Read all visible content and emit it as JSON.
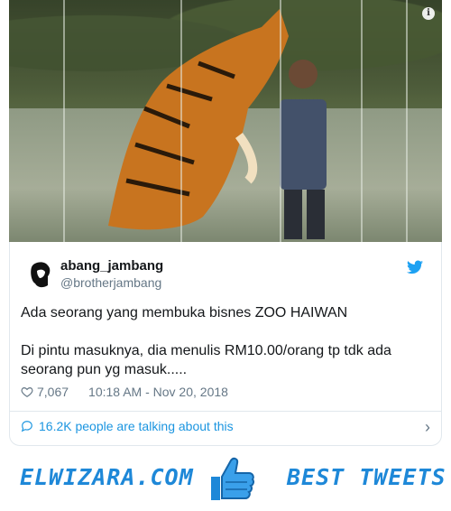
{
  "tweet": {
    "display_name": "abang_jambang",
    "handle": "@brotherjambang",
    "text_para1": "Ada seorang yang membuka bisnes ZOO HAIWAN",
    "text_para2_line1": "Di pintu masuknya, dia menulis RM10.00/orang tp tdk ada",
    "text_para2_line2": "seorang pun yg masuk.....",
    "likes": "7,067",
    "timestamp": "10:18 AM - Nov 20, 2018",
    "talking": "16.2K people are talking about this"
  },
  "banner": {
    "brand": "ELWIZARA.COM",
    "tagline": "BEST TWEETS"
  },
  "colors": {
    "accent": "#1b95e0",
    "brand": "#1e88d8",
    "muted": "#657786"
  },
  "icons": {
    "info": "info-icon",
    "twitter": "twitter-bird-icon",
    "like": "heart-icon",
    "talk": "speech-bubble-icon",
    "chevron": "chevron-right-icon",
    "thumb": "thumbs-up-icon"
  }
}
